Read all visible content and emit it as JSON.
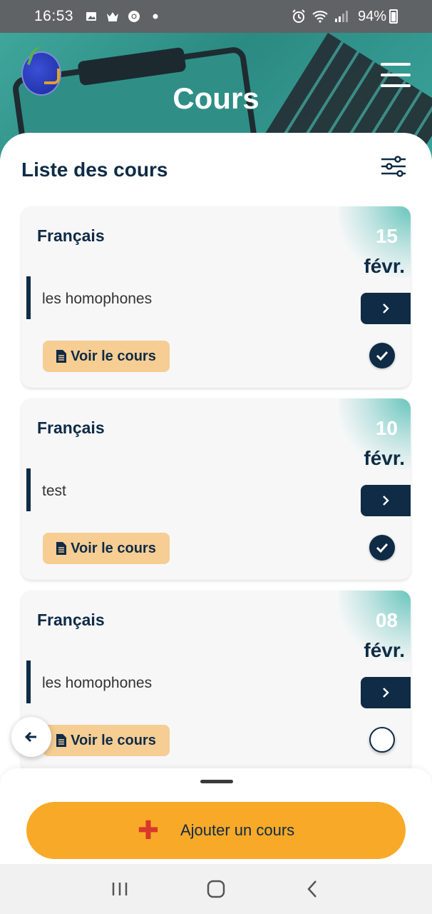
{
  "status_bar": {
    "time": "16:53",
    "battery": "94%",
    "left_icons": [
      "image-icon",
      "crown-icon",
      "chrome-icon",
      "dot-icon"
    ],
    "right_icons": [
      "alarm-icon",
      "wifi-icon",
      "signal-icon",
      "battery-icon"
    ]
  },
  "header": {
    "title": "Cours",
    "logo": "app-logo"
  },
  "list": {
    "heading": "Liste des cours",
    "voir_label": "Voir le cours",
    "courses": [
      {
        "subject": "Français",
        "day": "15",
        "month": "févr.",
        "topic": "les homophones",
        "done": true
      },
      {
        "subject": "Français",
        "day": "10",
        "month": "févr.",
        "topic": "test",
        "done": true
      },
      {
        "subject": "Français",
        "day": "08",
        "month": "févr.",
        "topic": "les homophones",
        "done": false
      }
    ]
  },
  "actions": {
    "add_label": "Ajouter un cours"
  },
  "colors": {
    "primary": "#0f2b46",
    "accent": "#f9a928",
    "teal": "#3fa69c",
    "voir_bg": "#f6cd93",
    "plus": "#d8382b"
  }
}
